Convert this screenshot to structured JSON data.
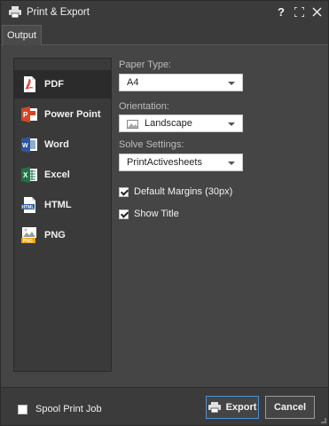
{
  "window": {
    "title": "Print & Export",
    "help_glyph": "?",
    "maximize_glyph": "⛶",
    "close_glyph": "✕",
    "icon": "printer-icon"
  },
  "tabs": [
    {
      "label": "Output",
      "active": true
    }
  ],
  "formats": [
    {
      "label": "PDF",
      "icon": "pdf-icon",
      "selected": true
    },
    {
      "label": "Power Point",
      "icon": "powerpoint-icon",
      "selected": false
    },
    {
      "label": "Word",
      "icon": "word-icon",
      "selected": false
    },
    {
      "label": "Excel",
      "icon": "excel-icon",
      "selected": false
    },
    {
      "label": "HTML",
      "icon": "html-icon",
      "selected": false
    },
    {
      "label": "PNG",
      "icon": "png-icon",
      "selected": false
    }
  ],
  "settings": {
    "paper_type": {
      "label": "Paper Type:",
      "value": "A4"
    },
    "orientation": {
      "label": "Orientation:",
      "value": "Landscape",
      "icon": "landscape-icon"
    },
    "solve_settings": {
      "label": "Solve Settings:",
      "value": "PrintActivesheets"
    },
    "default_margins": {
      "label": "Default Margins (30px)",
      "checked": true
    },
    "show_title": {
      "label": "Show Title",
      "checked": true
    }
  },
  "footer": {
    "spool_print_job": {
      "label": "Spool Print Job",
      "checked": false
    },
    "export_label": "Export",
    "cancel_label": "Cancel"
  },
  "colors": {
    "accent": "#4a90d9",
    "pdf": "#d93a2b",
    "powerpoint": "#d24726",
    "word": "#2b579a",
    "excel": "#217346",
    "png": "#e8a317"
  }
}
